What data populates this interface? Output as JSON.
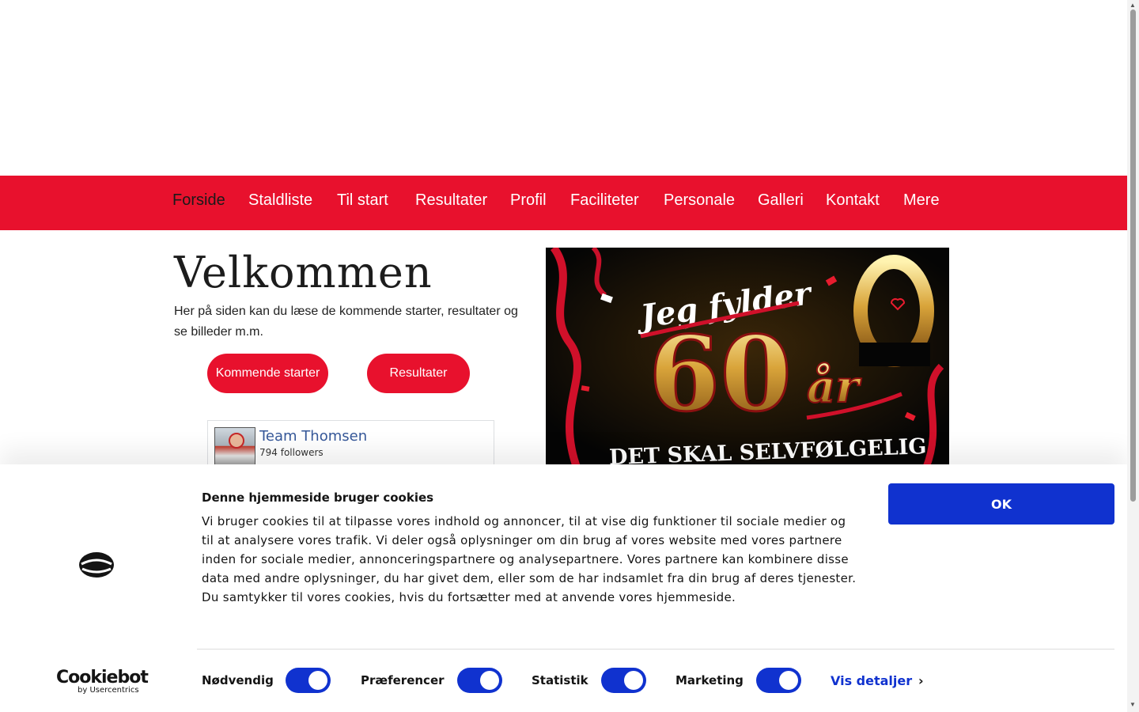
{
  "nav": {
    "items": [
      "Forside",
      "Staldliste",
      "Til start",
      "Resultater",
      "Profil",
      "Faciliteter",
      "Personale",
      "Galleri",
      "Kontakt",
      "Mere"
    ],
    "active": "Forside"
  },
  "colors": {
    "brand_red": "#e8112d",
    "cookie_blue": "#1032cf",
    "facebook_link": "#365899"
  },
  "welcome": {
    "title": "Velkommen",
    "text": "Her på siden kan du læse de kommende starter, resultater og se billeder m.m.",
    "button_upcoming": "Kommende starter",
    "button_results": "Resultater"
  },
  "facebook": {
    "page_name": "Team Thomsen",
    "followers": "794 followers"
  },
  "promo": {
    "line1": "Jeg fylder",
    "number": "60",
    "suffix": "år",
    "line2": "DET SKAL SELVFØLGELIG"
  },
  "cookie": {
    "title": "Denne hjemmeside bruger cookies",
    "text": "Vi bruger cookies til at tilpasse vores indhold og annoncer, til at vise dig funktioner til sociale medier og til at analysere vores trafik. Vi deler også oplysninger om din brug af vores website med vores partnere inden for sociale medier, annonceringspartnere og analysepartnere. Vores partnere kan kombinere disse data med andre oplysninger, du har givet dem, eller som de har indsamlet fra din brug af deres tjenester. Du samtykker til vores cookies, hvis du fortsætter med at anvende vores hjemmeside.",
    "ok_label": "OK",
    "toggles": [
      {
        "label": "Nødvendig",
        "on": true
      },
      {
        "label": "Præferencer",
        "on": true
      },
      {
        "label": "Statistik",
        "on": true
      },
      {
        "label": "Marketing",
        "on": true
      }
    ],
    "details_label": "Vis detaljer",
    "brand": "Cookiebot",
    "brand_sub": "by Usercentrics"
  }
}
